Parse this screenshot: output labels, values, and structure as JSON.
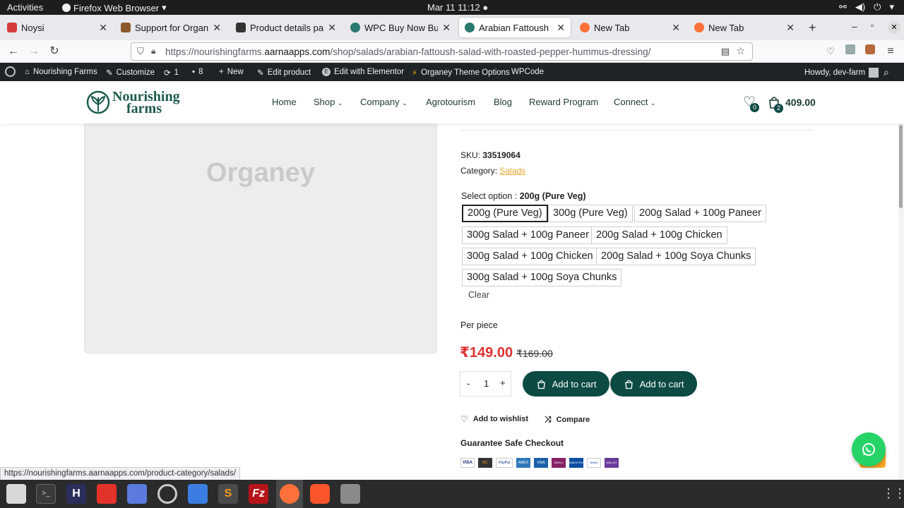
{
  "system": {
    "activities": "Activities",
    "app_menu": "Firefox Web Browser",
    "clock": "Mar 11  11:12"
  },
  "tabs": [
    {
      "title": "Noysi",
      "color": "#d23b3b"
    },
    {
      "title": "Support for Organey -",
      "color": "#8b5a2b"
    },
    {
      "title": "Product details page",
      "color": "#333333"
    },
    {
      "title": "WPC Buy Now Button",
      "color": "#2a7a6f"
    },
    {
      "title": "Arabian Fattoush Sala",
      "color": "#2a7a6f"
    },
    {
      "title": "New Tab",
      "color": "#ff7139"
    },
    {
      "title": "New Tab",
      "color": "#ff7139"
    }
  ],
  "browser": {
    "url_prefix": "https://nourishingfarms.",
    "url_host": "aarnaapps.com",
    "url_path": "/shop/salads/arabian-fattoush-salad-with-roasted-pepper-hummus-dressing/"
  },
  "wp_admin": {
    "site": "Nourishing Farms",
    "customize": "Customize",
    "updates": "1",
    "comments": "8",
    "new": "New",
    "edit_product": "Edit product",
    "elementor": "Edit with Elementor",
    "theme_options": "Organey Theme Options",
    "wpcode": "WPCode",
    "howdy": "Howdy, dev-farm"
  },
  "site": {
    "logo_line1": "Nourishing",
    "logo_line2": "farms",
    "menu": [
      "Home",
      "Shop",
      "Company",
      "Agrotourism",
      "Blog",
      "Reward Program",
      "Connect"
    ],
    "wishlist_count": "0",
    "cart_count": "2",
    "cart_total": "409.00"
  },
  "product": {
    "placeholder": "Organey",
    "sku_label": "SKU:",
    "sku": "33519064",
    "category_label": "Category:",
    "category": "Salads",
    "select_label": "Select option :",
    "selected_option": "200g (Pure Veg)",
    "options": [
      "200g (Pure Veg)",
      "300g (Pure Veg)",
      "200g Salad + 100g Paneer",
      "300g Salad + 100g Paneer",
      "200g Salad + 100g Chicken",
      "300g Salad + 100g Chicken",
      "200g Salad + 100g Soya Chunks",
      "300g Salad + 100g Soya Chunks"
    ],
    "clear": "Clear",
    "unit": "Per piece",
    "price": "₹149.00",
    "old_price": "₹169.00",
    "qty": "1",
    "add_to_cart": "Add to cart",
    "add_to_cart_2": "Add to cart",
    "wishlist": "Add to wishlist",
    "compare": "Compare",
    "guarantee": "Guarantee Safe Checkout",
    "payments": [
      "VISA",
      "MC",
      "PayPal",
      "AMEX",
      "VISA",
      "SKRILL",
      "MAESTRO",
      "BANK",
      "WALLET"
    ]
  },
  "status_url": "https://nourishingfarms.aarnaapps.com/product-category/salads/",
  "colors": {
    "brand": "#0d4a43",
    "price": "#e03131",
    "link": "#e5a52a"
  }
}
